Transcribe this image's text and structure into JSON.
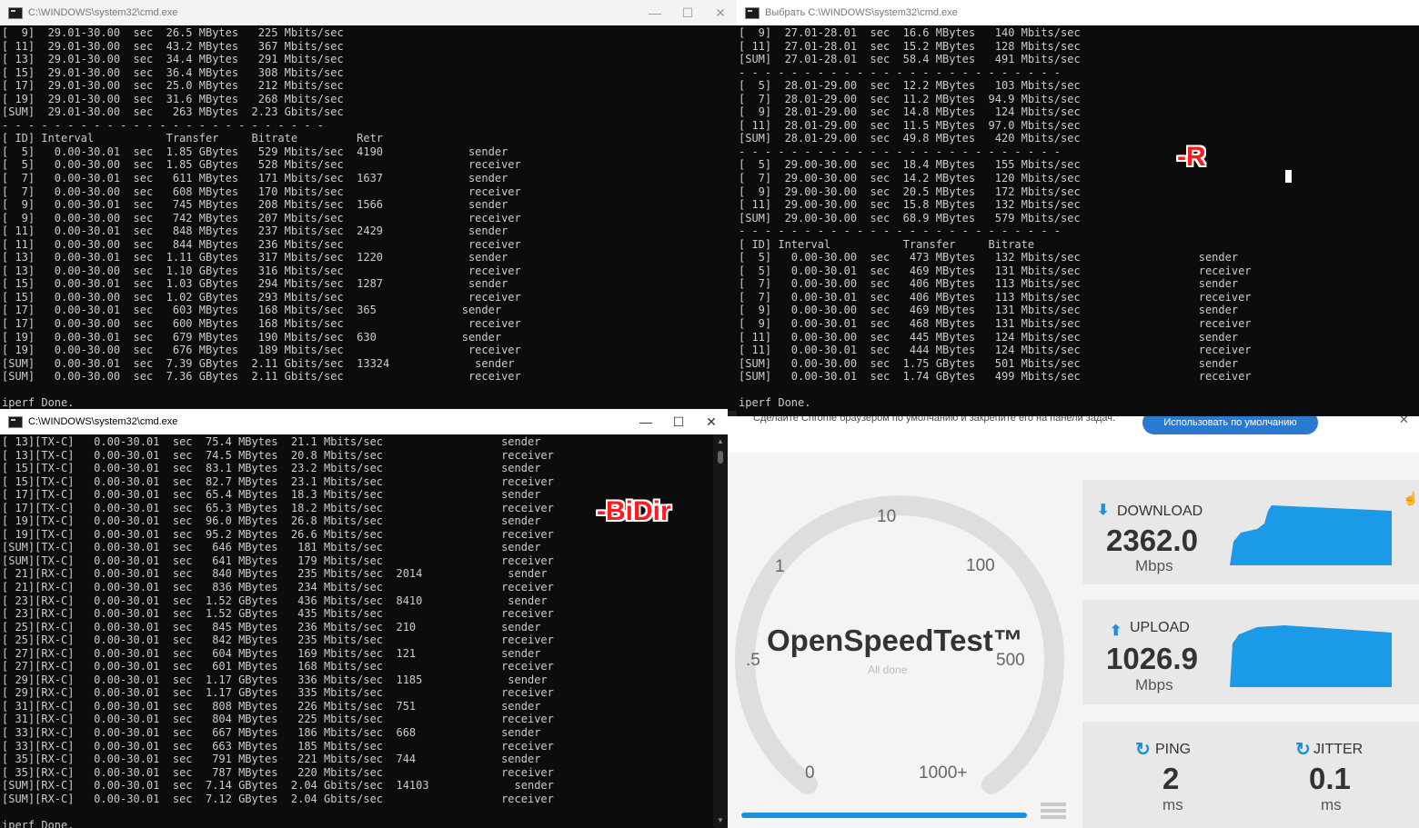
{
  "windows": {
    "left_top": {
      "title": "C:\\WINDOWS\\system32\\cmd.exe",
      "lines": [
        "[  9]  29.01-30.00  sec  26.5 MBytes   225 Mbits/sec",
        "[ 11]  29.01-30.00  sec  43.2 MBytes   367 Mbits/sec",
        "[ 13]  29.01-30.00  sec  34.4 MBytes   291 Mbits/sec",
        "[ 15]  29.01-30.00  sec  36.4 MBytes   308 Mbits/sec",
        "[ 17]  29.01-30.00  sec  25.0 MBytes   212 Mbits/sec",
        "[ 19]  29.01-30.00  sec  31.6 MBytes   268 Mbits/sec",
        "[SUM]  29.01-30.00  sec   263 MBytes  2.23 Gbits/sec",
        "- - - - - - - - - - - - - - - - - - - - - - - - -",
        "[ ID] Interval           Transfer     Bitrate         Retr",
        "[  5]   0.00-30.01  sec  1.85 GBytes   529 Mbits/sec  4190             sender",
        "[  5]   0.00-30.00  sec  1.85 GBytes   528 Mbits/sec                   receiver",
        "[  7]   0.00-30.01  sec   611 MBytes   171 Mbits/sec  1637             sender",
        "[  7]   0.00-30.00  sec   608 MBytes   170 Mbits/sec                   receiver",
        "[  9]   0.00-30.01  sec   745 MBytes   208 Mbits/sec  1566             sender",
        "[  9]   0.00-30.00  sec   742 MBytes   207 Mbits/sec                   receiver",
        "[ 11]   0.00-30.01  sec   848 MBytes   237 Mbits/sec  2429             sender",
        "[ 11]   0.00-30.00  sec   844 MBytes   236 Mbits/sec                   receiver",
        "[ 13]   0.00-30.01  sec  1.11 GBytes   317 Mbits/sec  1220             sender",
        "[ 13]   0.00-30.00  sec  1.10 GBytes   316 Mbits/sec                   receiver",
        "[ 15]   0.00-30.01  sec  1.03 GBytes   294 Mbits/sec  1287             sender",
        "[ 15]   0.00-30.00  sec  1.02 GBytes   293 Mbits/sec                   receiver",
        "[ 17]   0.00-30.01  sec   603 MBytes   168 Mbits/sec  365             sender",
        "[ 17]   0.00-30.00  sec   600 MBytes   168 Mbits/sec                   receiver",
        "[ 19]   0.00-30.01  sec   679 MBytes   190 Mbits/sec  630             sender",
        "[ 19]   0.00-30.00  sec   676 MBytes   189 Mbits/sec                   receiver",
        "[SUM]   0.00-30.01  sec  7.39 GBytes  2.11 Gbits/sec  13324             sender",
        "[SUM]   0.00-30.00  sec  7.36 GBytes  2.11 Gbits/sec                   receiver",
        "",
        "iperf Done."
      ]
    },
    "right_top": {
      "title": "Выбрать C:\\WINDOWS\\system32\\cmd.exe",
      "label": "-R",
      "lines": [
        "[  9]  27.01-28.01  sec  16.6 MBytes   140 Mbits/sec",
        "[ 11]  27.01-28.01  sec  15.2 MBytes   128 Mbits/sec",
        "[SUM]  27.01-28.01  sec  58.4 MBytes   491 Mbits/sec",
        "- - - - - - - - - - - - - - - - - - - - - - - - -",
        "[  5]  28.01-29.00  sec  12.2 MBytes   103 Mbits/sec",
        "[  7]  28.01-29.00  sec  11.2 MBytes  94.9 Mbits/sec",
        "[  9]  28.01-29.00  sec  14.8 MBytes   124 Mbits/sec",
        "[ 11]  28.01-29.00  sec  11.5 MBytes  97.0 Mbits/sec",
        "[SUM]  28.01-29.00  sec  49.8 MBytes   420 Mbits/sec",
        "- - - - - - - - - - - - - - - - - - - - - - - - -",
        "[  5]  29.00-30.00  sec  18.4 MBytes   155 Mbits/sec",
        "[  7]  29.00-30.00  sec  14.2 MBytes   120 Mbits/sec",
        "[  9]  29.00-30.00  sec  20.5 MBytes   172 Mbits/sec",
        "[ 11]  29.00-30.00  sec  15.8 MBytes   132 Mbits/sec",
        "[SUM]  29.00-30.00  sec  68.9 MBytes   579 Mbits/sec",
        "- - - - - - - - - - - - - - - - - - - - - - - - -",
        "[ ID] Interval           Transfer     Bitrate",
        "[  5]   0.00-30.00  sec   473 MBytes   132 Mbits/sec                  sender",
        "[  5]   0.00-30.01  sec   469 MBytes   131 Mbits/sec                  receiver",
        "[  7]   0.00-30.00  sec   406 MBytes   113 Mbits/sec                  sender",
        "[  7]   0.00-30.01  sec   406 MBytes   113 Mbits/sec                  receiver",
        "[  9]   0.00-30.00  sec   469 MBytes   131 Mbits/sec                  sender",
        "[  9]   0.00-30.01  sec   468 MBytes   131 Mbits/sec                  receiver",
        "[ 11]   0.00-30.00  sec   445 MBytes   124 Mbits/sec                  sender",
        "[ 11]   0.00-30.01  sec   444 MBytes   124 Mbits/sec                  receiver",
        "[SUM]   0.00-30.00  sec  1.75 GBytes   501 Mbits/sec                  sender",
        "[SUM]   0.00-30.01  sec  1.74 GBytes   499 Mbits/sec                  receiver",
        "",
        "iperf Done."
      ]
    },
    "left_bottom": {
      "title": "C:\\WINDOWS\\system32\\cmd.exe",
      "label": "-BiDir",
      "lines": [
        "[ 13][TX-C]   0.00-30.01  sec  75.4 MBytes  21.1 Mbits/sec                  sender",
        "[ 13][TX-C]   0.00-30.01  sec  74.5 MBytes  20.8 Mbits/sec                  receiver",
        "[ 15][TX-C]   0.00-30.01  sec  83.1 MBytes  23.2 Mbits/sec                  sender",
        "[ 15][TX-C]   0.00-30.01  sec  82.7 MBytes  23.1 Mbits/sec                  receiver",
        "[ 17][TX-C]   0.00-30.01  sec  65.4 MBytes  18.3 Mbits/sec                  sender",
        "[ 17][TX-C]   0.00-30.01  sec  65.3 MBytes  18.2 Mbits/sec                  receiver",
        "[ 19][TX-C]   0.00-30.01  sec  96.0 MBytes  26.8 Mbits/sec                  sender",
        "[ 19][TX-C]   0.00-30.01  sec  95.2 MBytes  26.6 Mbits/sec                  receiver",
        "[SUM][TX-C]   0.00-30.01  sec   646 MBytes   181 Mbits/sec                  sender",
        "[SUM][TX-C]   0.00-30.01  sec   641 MBytes   179 Mbits/sec                  receiver",
        "[ 21][RX-C]   0.00-30.01  sec   840 MBytes   235 Mbits/sec  2014             sender",
        "[ 21][RX-C]   0.00-30.01  sec   836 MBytes   234 Mbits/sec                  receiver",
        "[ 23][RX-C]   0.00-30.01  sec  1.52 GBytes   436 Mbits/sec  8410             sender",
        "[ 23][RX-C]   0.00-30.01  sec  1.52 GBytes   435 Mbits/sec                  receiver",
        "[ 25][RX-C]   0.00-30.01  sec   845 MBytes   236 Mbits/sec  210             sender",
        "[ 25][RX-C]   0.00-30.01  sec   842 MBytes   235 Mbits/sec                  receiver",
        "[ 27][RX-C]   0.00-30.01  sec   604 MBytes   169 Mbits/sec  121             sender",
        "[ 27][RX-C]   0.00-30.01  sec   601 MBytes   168 Mbits/sec                  receiver",
        "[ 29][RX-C]   0.00-30.01  sec  1.17 GBytes   336 Mbits/sec  1185             sender",
        "[ 29][RX-C]   0.00-30.01  sec  1.17 GBytes   335 Mbits/sec                  receiver",
        "[ 31][RX-C]   0.00-30.01  sec   808 MBytes   226 Mbits/sec  751             sender",
        "[ 31][RX-C]   0.00-30.01  sec   804 MBytes   225 Mbits/sec                  receiver",
        "[ 33][RX-C]   0.00-30.01  sec   667 MBytes   186 Mbits/sec  668             sender",
        "[ 33][RX-C]   0.00-30.01  sec   663 MBytes   185 Mbits/sec                  receiver",
        "[ 35][RX-C]   0.00-30.01  sec   791 MBytes   221 Mbits/sec  744             sender",
        "[ 35][RX-C]   0.00-30.01  sec   787 MBytes   220 Mbits/sec                  receiver",
        "[SUM][RX-C]   0.00-30.01  sec  7.14 GBytes  2.04 Gbits/sec  14103             sender",
        "[SUM][RX-C]   0.00-30.01  sec  7.12 GBytes  2.04 Gbits/sec                  receiver",
        "",
        "iperf Done."
      ]
    }
  },
  "window_controls": {
    "minimize": "—",
    "maximize": "☐",
    "close": "✕"
  },
  "chrome_bar": {
    "message": "Сделайте Chrome браузером по умолчанию и закрепите его на панели задач.",
    "button": "Использовать по умолчанию",
    "close": "✕"
  },
  "speedtest": {
    "brand": "OpenSpeedTest™",
    "status": "All done",
    "gauge_ticks": [
      ".5",
      "1",
      "10",
      "100",
      "500",
      "0",
      "1000+"
    ],
    "progress": 1.0,
    "download": {
      "label": "DOWNLOAD",
      "value": "2362.0",
      "unit": "Mbps"
    },
    "upload": {
      "label": "UPLOAD",
      "value": "1026.9",
      "unit": "Mbps"
    },
    "ping": {
      "label": "PING",
      "value": "2",
      "unit": "ms"
    },
    "jitter": {
      "label": "JITTER",
      "value": "0.1",
      "unit": "ms"
    },
    "accent_color": "#1b8fe0"
  }
}
